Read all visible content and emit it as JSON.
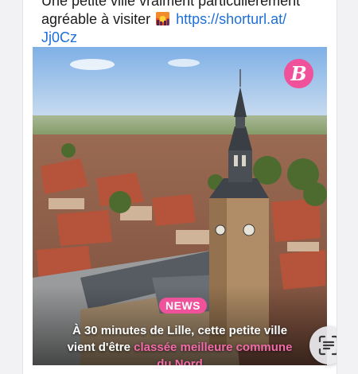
{
  "post": {
    "text_line1_partial": "Une petite ville vraiment particulièrement",
    "text_line2": "agréable à visiter",
    "link_part1": "https://shorturl.at/",
    "link_part2": "Jj0Cz"
  },
  "media": {
    "brand_logo_letter": "B",
    "badge": "NEWS",
    "headline_line1": "À 30 minutes de Lille, cette petite ville",
    "headline_line2_start": "vient d'être ",
    "headline_line2_highlight": "classée meilleure commune",
    "headline_line3_partial": "du Nord"
  },
  "colors": {
    "brand_pink": "#f0519b",
    "link_blue": "#1d6fd8"
  },
  "icons": {
    "emoji": "sunset-emoji",
    "scan": "text-scan-icon"
  }
}
